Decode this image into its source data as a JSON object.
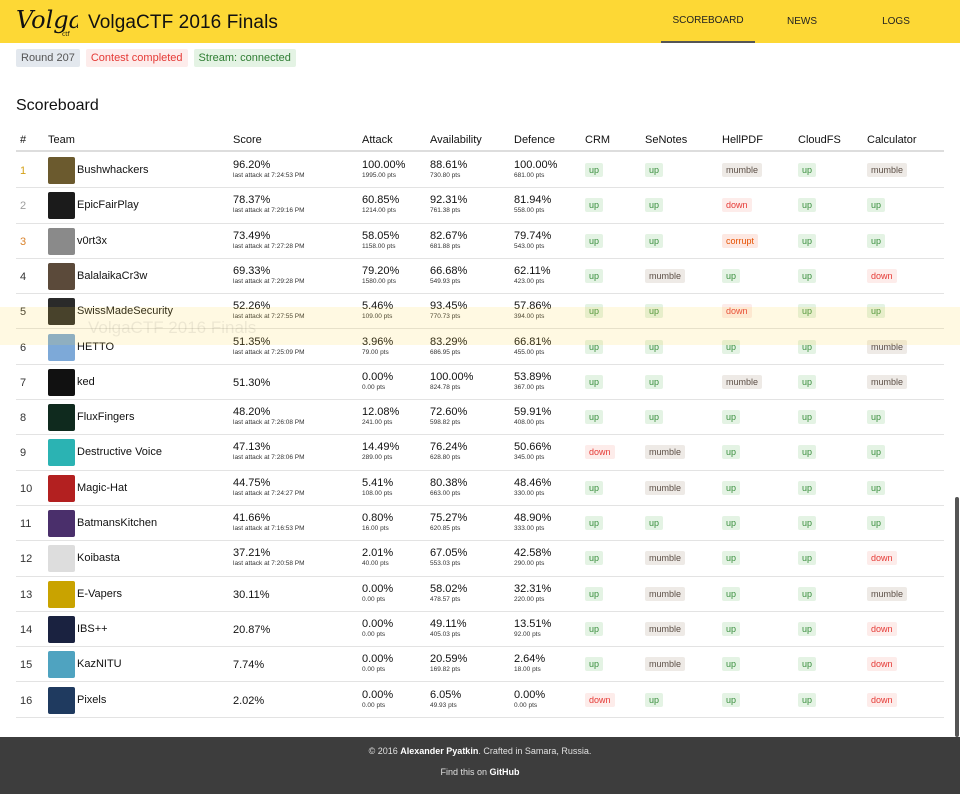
{
  "header": {
    "logo_text": "Volga",
    "title": "VolgaCTF 2016 Finals",
    "nav": [
      "SCOREBOARD",
      "NEWS",
      "LOGS"
    ]
  },
  "status": {
    "round": "Round 207",
    "contest": "Contest completed",
    "stream": "Stream: connected"
  },
  "ghost_title": "VolgaCTF 2016 Finals",
  "section_title": "Scoreboard",
  "columns": [
    "#",
    "Team",
    "Score",
    "Attack",
    "Availability",
    "Defence",
    "CRM",
    "SeNotes",
    "HellPDF",
    "CloudFS",
    "Calculator"
  ],
  "rows": [
    {
      "rank": "1",
      "team": "Bushwhackers",
      "avatar": "#6b5a2e",
      "score": "96.20%",
      "last": "last attack at 7:24:53 PM",
      "attack": "100.00%",
      "attack_pts": "1995.00 pts",
      "avail": "88.61%",
      "avail_pts": "730.80 pts",
      "def": "100.00%",
      "def_pts": "681.00 pts",
      "svc": [
        "up",
        "up",
        "mumble",
        "up",
        "mumble"
      ]
    },
    {
      "rank": "2",
      "team": "EpicFairPlay",
      "avatar": "#1b1b1b",
      "score": "78.37%",
      "last": "last attack at 7:29:16 PM",
      "attack": "60.85%",
      "attack_pts": "1214.00 pts",
      "avail": "92.31%",
      "avail_pts": "761.38 pts",
      "def": "81.94%",
      "def_pts": "558.00 pts",
      "svc": [
        "up",
        "up",
        "down",
        "up",
        "up"
      ]
    },
    {
      "rank": "3",
      "team": "v0rt3x",
      "avatar": "#8a8a8a",
      "score": "73.49%",
      "last": "last attack at 7:27:28 PM",
      "attack": "58.05%",
      "attack_pts": "1158.00 pts",
      "avail": "82.67%",
      "avail_pts": "681.88 pts",
      "def": "79.74%",
      "def_pts": "543.00 pts",
      "svc": [
        "up",
        "up",
        "corrupt",
        "up",
        "up"
      ]
    },
    {
      "rank": "4",
      "team": "BalalaikaCr3w",
      "avatar": "#5b4a3a",
      "score": "69.33%",
      "last": "last attack at 7:29:28 PM",
      "attack": "79.20%",
      "attack_pts": "1580.00 pts",
      "avail": "66.68%",
      "avail_pts": "549.93 pts",
      "def": "62.11%",
      "def_pts": "423.00 pts",
      "svc": [
        "up",
        "mumble",
        "up",
        "up",
        "down"
      ]
    },
    {
      "rank": "5",
      "team": "SwissMadeSecurity",
      "avatar": "#2a2a2a",
      "score": "52.26%",
      "last": "last attack at 7:27:55 PM",
      "attack": "5.46%",
      "attack_pts": "109.00 pts",
      "avail": "93.45%",
      "avail_pts": "770.73 pts",
      "def": "57.86%",
      "def_pts": "394.00 pts",
      "svc": [
        "up",
        "up",
        "down",
        "up",
        "up"
      ]
    },
    {
      "rank": "6",
      "team": "HETTO",
      "avatar": "#7da9d8",
      "score": "51.35%",
      "last": "last attack at 7:25:09 PM",
      "attack": "3.96%",
      "attack_pts": "79.00 pts",
      "avail": "83.29%",
      "avail_pts": "686.95 pts",
      "def": "66.81%",
      "def_pts": "455.00 pts",
      "svc": [
        "up",
        "up",
        "up",
        "up",
        "mumble"
      ]
    },
    {
      "rank": "7",
      "team": "ked",
      "avatar": "#111111",
      "score": "51.30%",
      "last": "",
      "attack": "0.00%",
      "attack_pts": "0.00 pts",
      "avail": "100.00%",
      "avail_pts": "824.78 pts",
      "def": "53.89%",
      "def_pts": "367.00 pts",
      "svc": [
        "up",
        "up",
        "mumble",
        "up",
        "mumble"
      ]
    },
    {
      "rank": "8",
      "team": "FluxFingers",
      "avatar": "#0f2a1e",
      "score": "48.20%",
      "last": "last attack at 7:26:08 PM",
      "attack": "12.08%",
      "attack_pts": "241.00 pts",
      "avail": "72.60%",
      "avail_pts": "598.82 pts",
      "def": "59.91%",
      "def_pts": "408.00 pts",
      "svc": [
        "up",
        "up",
        "up",
        "up",
        "up"
      ]
    },
    {
      "rank": "9",
      "team": "Destructive Voice",
      "avatar": "#2bb3b3",
      "score": "47.13%",
      "last": "last attack at 7:28:06 PM",
      "attack": "14.49%",
      "attack_pts": "289.00 pts",
      "avail": "76.24%",
      "avail_pts": "628.80 pts",
      "def": "50.66%",
      "def_pts": "345.00 pts",
      "svc": [
        "down",
        "mumble",
        "up",
        "up",
        "up"
      ]
    },
    {
      "rank": "10",
      "team": "Magic-Hat",
      "avatar": "#b32020",
      "score": "44.75%",
      "last": "last attack at 7:24:27 PM",
      "attack": "5.41%",
      "attack_pts": "108.00 pts",
      "avail": "80.38%",
      "avail_pts": "663.00 pts",
      "def": "48.46%",
      "def_pts": "330.00 pts",
      "svc": [
        "up",
        "mumble",
        "up",
        "up",
        "up"
      ]
    },
    {
      "rank": "11",
      "team": "BatmansKitchen",
      "avatar": "#4a2f6b",
      "score": "41.66%",
      "last": "last attack at 7:16:53 PM",
      "attack": "0.80%",
      "attack_pts": "16.00 pts",
      "avail": "75.27%",
      "avail_pts": "620.85 pts",
      "def": "48.90%",
      "def_pts": "333.00 pts",
      "svc": [
        "up",
        "up",
        "up",
        "up",
        "up"
      ]
    },
    {
      "rank": "12",
      "team": "Koibasta",
      "avatar": "#dddddd",
      "score": "37.21%",
      "last": "last attack at 7:20:58 PM",
      "attack": "2.01%",
      "attack_pts": "40.00 pts",
      "avail": "67.05%",
      "avail_pts": "553.03 pts",
      "def": "42.58%",
      "def_pts": "290.00 pts",
      "svc": [
        "up",
        "mumble",
        "up",
        "up",
        "down"
      ]
    },
    {
      "rank": "13",
      "team": "E-Vapers",
      "avatar": "#c9a300",
      "score": "30.11%",
      "last": "",
      "attack": "0.00%",
      "attack_pts": "0.00 pts",
      "avail": "58.02%",
      "avail_pts": "478.57 pts",
      "def": "32.31%",
      "def_pts": "220.00 pts",
      "svc": [
        "up",
        "mumble",
        "up",
        "up",
        "mumble"
      ]
    },
    {
      "rank": "14",
      "team": "IBS++",
      "avatar": "#1a2240",
      "score": "20.87%",
      "last": "",
      "attack": "0.00%",
      "attack_pts": "0.00 pts",
      "avail": "49.11%",
      "avail_pts": "405.03 pts",
      "def": "13.51%",
      "def_pts": "92.00 pts",
      "svc": [
        "up",
        "mumble",
        "up",
        "up",
        "down"
      ]
    },
    {
      "rank": "15",
      "team": "KazNITU",
      "avatar": "#4fa3c0",
      "score": "7.74%",
      "last": "",
      "attack": "0.00%",
      "attack_pts": "0.00 pts",
      "avail": "20.59%",
      "avail_pts": "169.82 pts",
      "def": "2.64%",
      "def_pts": "18.00 pts",
      "svc": [
        "up",
        "mumble",
        "up",
        "up",
        "down"
      ]
    },
    {
      "rank": "16",
      "team": "Pixels",
      "avatar": "#1f3a5f",
      "score": "2.02%",
      "last": "",
      "attack": "0.00%",
      "attack_pts": "0.00 pts",
      "avail": "6.05%",
      "avail_pts": "49.93 pts",
      "def": "0.00%",
      "def_pts": "0.00 pts",
      "svc": [
        "down",
        "up",
        "up",
        "up",
        "down"
      ]
    }
  ],
  "footer": {
    "copyright_prefix": "© 2016 ",
    "author": "Alexander Pyatkin",
    "copyright_suffix": ". Crafted in Samara, Russia.",
    "find_prefix": "Find this on ",
    "github": "GitHub"
  }
}
